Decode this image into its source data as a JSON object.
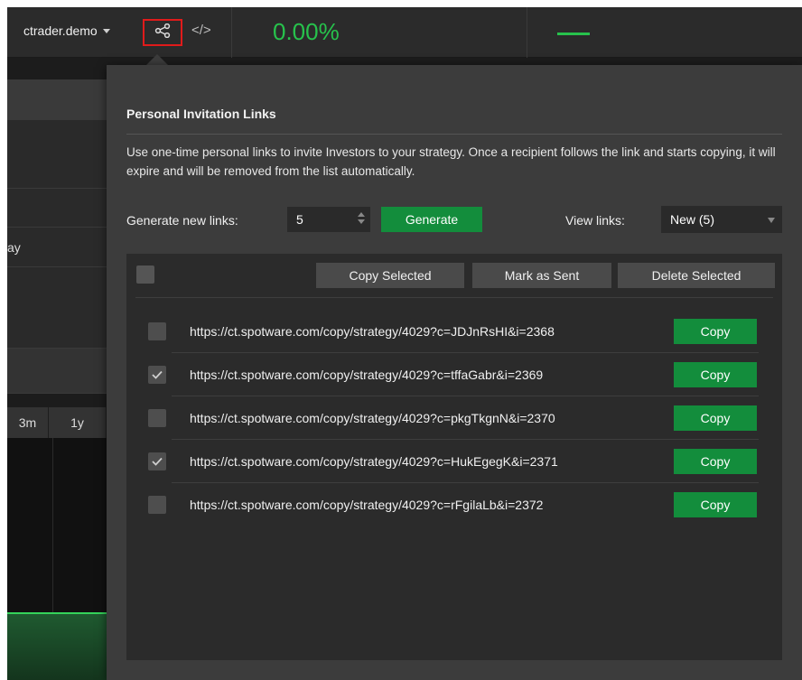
{
  "topbar": {
    "account_name": "ctrader.demo",
    "code_icon_text": "</>",
    "percent": "0.00%",
    "accent_green": "#27c24c"
  },
  "background": {
    "row_label_partial": "ay",
    "period_tab_partial": "3m",
    "period_tab_1y": "1y"
  },
  "popup": {
    "title": "Personal Invitation Links",
    "description": "Use one-time personal links to invite Investors to your strategy. Once a recipient follows the link and starts copying, it will expire and will be removed from the list automatically.",
    "generate_label": "Generate new links:",
    "generate_count": "5",
    "generate_button": "Generate",
    "view_label": "View links:",
    "view_selected": "New (5)",
    "toolbar": {
      "copy_selected": "Copy Selected",
      "mark_as_sent": "Mark as Sent",
      "delete_selected": "Delete Selected"
    },
    "links": [
      {
        "url": "https://ct.spotware.com/copy/strategy/4029?c=JDJnRsHI&i=2368",
        "checked": false,
        "button": "Copy"
      },
      {
        "url": "https://ct.spotware.com/copy/strategy/4029?c=tffaGabr&i=2369",
        "checked": true,
        "button": "Copy"
      },
      {
        "url": "https://ct.spotware.com/copy/strategy/4029?c=pkgTkgnN&i=2370",
        "checked": false,
        "button": "Copy"
      },
      {
        "url": "https://ct.spotware.com/copy/strategy/4029?c=HukEgegK&i=2371",
        "checked": true,
        "button": "Copy"
      },
      {
        "url": "https://ct.spotware.com/copy/strategy/4029?c=rFgilaLb&i=2372",
        "checked": false,
        "button": "Copy"
      }
    ]
  }
}
